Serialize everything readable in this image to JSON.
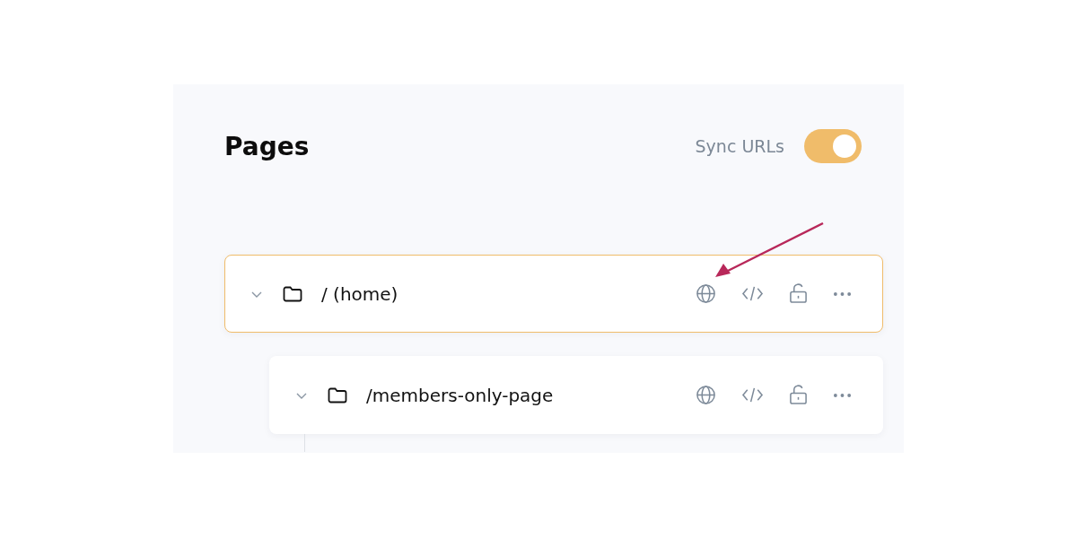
{
  "title": "Pages",
  "sync": {
    "label": "Sync URLs",
    "on": true
  },
  "pages": [
    {
      "path": "/ (home)",
      "selected": true,
      "expanded": true,
      "children": [
        {
          "path": "/members-only-page",
          "selected": false,
          "expanded": true
        }
      ]
    }
  ]
}
